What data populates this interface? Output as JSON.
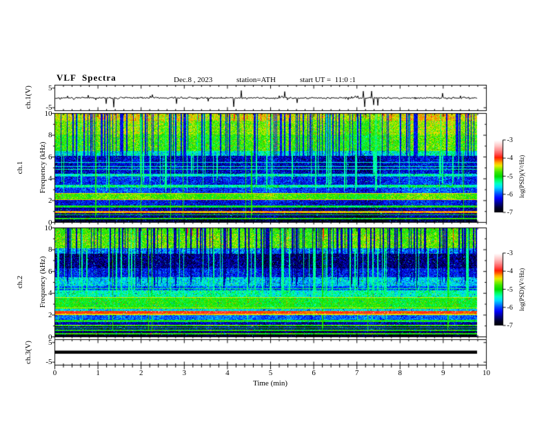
{
  "title": "VLF  Spectra",
  "header": {
    "date": "Dec.8 , 2023",
    "station": "station=ATH",
    "start_ut": "start UT =  11:0 :1"
  },
  "x_axis": {
    "label": "Time (min)",
    "min": 0,
    "max": 10,
    "tick_labels": [
      "0",
      "1",
      "2",
      "3",
      "4",
      "5",
      "6",
      "7",
      "8",
      "9",
      "10"
    ],
    "minor_per_major": 5
  },
  "panels": [
    {
      "name": "ch.1(V)",
      "yticks": [
        "5",
        "-5"
      ]
    },
    {
      "name": "ch.1",
      "axis": "Frequency (kHz)",
      "yticks": [
        "10",
        "8",
        "6",
        "4",
        "2",
        "0"
      ]
    },
    {
      "name": "ch.2",
      "axis": "Frequency (kHz)",
      "yticks": [
        "10",
        "8",
        "6",
        "4",
        "2",
        "0"
      ]
    },
    {
      "name": "ch.3(V)",
      "yticks": [
        "5",
        "-5"
      ]
    }
  ],
  "colorbar": {
    "label": "log(PSD)(V²/Hz)",
    "tick_labels": [
      "-3",
      "-4",
      "-5",
      "-6",
      "-7"
    ],
    "top_value": -3,
    "bottom_value": -7,
    "gradient_stops": [
      [
        -7.0,
        0,
        0,
        0
      ],
      [
        -6.75,
        0,
        0,
        40
      ],
      [
        -6.5,
        0,
        0,
        130
      ],
      [
        -6.2,
        0,
        0,
        255
      ],
      [
        -6.0,
        0,
        60,
        255
      ],
      [
        -5.8,
        0,
        140,
        255
      ],
      [
        -5.6,
        0,
        220,
        255
      ],
      [
        -5.4,
        0,
        255,
        200
      ],
      [
        -5.2,
        0,
        255,
        100
      ],
      [
        -5.0,
        0,
        220,
        0
      ],
      [
        -4.75,
        60,
        230,
        0
      ],
      [
        -4.55,
        150,
        240,
        0
      ],
      [
        -4.4,
        235,
        235,
        0
      ],
      [
        -4.25,
        255,
        180,
        0
      ],
      [
        -4.1,
        255,
        100,
        0
      ],
      [
        -3.95,
        255,
        30,
        0
      ],
      [
        -3.8,
        255,
        70,
        70
      ],
      [
        -3.55,
        255,
        140,
        140
      ],
      [
        -3.3,
        255,
        200,
        200
      ],
      [
        -3.0,
        255,
        255,
        255
      ]
    ]
  },
  "chart_data": [
    {
      "type": "line",
      "series": "ch.1 voltage waveform",
      "xlabel": "Time (min)",
      "ylabel": "ch.1(V)",
      "x_range": [
        0,
        9.79
      ],
      "y_range": [
        -5,
        5
      ],
      "baseline_V": 0,
      "noise_amplitude_V": 0.55,
      "downward_spikes_to_V": -5,
      "upward_spikes_to_V": 4,
      "line_color": "#000000"
    },
    {
      "type": "heatmap",
      "series": "ch.1 spectrogram",
      "xlabel": "Time (min)",
      "ylabel": "Frequency (kHz)",
      "x_range": [
        0,
        9.79
      ],
      "y_range": [
        0,
        10
      ],
      "z_label": "log(PSD)(V²/Hz)",
      "z_range": [
        -7,
        -3
      ],
      "band_format": [
        "f_high_kHz",
        "f_low_kHz",
        "mean_log_psd",
        "noise"
      ],
      "bands": [
        [
          10.0,
          9.4,
          -4.45,
          0.3
        ],
        [
          9.4,
          8.1,
          -4.65,
          0.3
        ],
        [
          8.1,
          6.6,
          -4.85,
          0.35
        ],
        [
          6.6,
          6.1,
          -5.5,
          0.4
        ],
        [
          6.1,
          4.45,
          -6.35,
          0.4
        ],
        [
          4.45,
          4.2,
          -5.5,
          0.3
        ],
        [
          4.2,
          3.45,
          -6.15,
          0.35
        ],
        [
          3.45,
          3.2,
          -5.35,
          0.3
        ],
        [
          3.2,
          2.65,
          -6.05,
          0.35
        ],
        [
          2.65,
          2.05,
          -4.8,
          0.3
        ],
        [
          2.05,
          1.5,
          -6.25,
          0.35
        ],
        [
          1.5,
          1.3,
          -5.0,
          0.25
        ],
        [
          1.3,
          1.0,
          -6.45,
          0.3
        ],
        [
          1.0,
          0.82,
          -4.35,
          0.25
        ],
        [
          0.82,
          0.38,
          -6.55,
          0.3
        ],
        [
          0.38,
          0.22,
          -5.0,
          0.25
        ],
        [
          0.22,
          0.0,
          -6.8,
          0.25
        ]
      ],
      "lines": [
        [
          5.5,
          -5.45
        ],
        [
          5.15,
          -5.4
        ],
        [
          4.85,
          -5.35
        ],
        [
          2.62,
          -4.35
        ],
        [
          2.08,
          -4.3
        ],
        [
          0.9,
          -4.2
        ],
        [
          0.62,
          -5.0
        ],
        [
          0.3,
          -4.8
        ]
      ],
      "streaks": {
        "dark": {
          "count": 150,
          "f_bottom": [
            4.3,
            6.5
          ],
          "level": -6.2
        },
        "bright": {
          "count": 60,
          "f_bottom": [
            2.7,
            4.5
          ],
          "level": -5.3
        },
        "red": {
          "count": 12,
          "f_bottom": [
            9.3,
            9.7
          ],
          "level": -3.9
        },
        "green": {
          "count": 8,
          "f_bottom": [
            0.3,
            0.5
          ],
          "level": -4.95
        }
      },
      "spots": {
        "f_min": 9.3,
        "prob": 0.012,
        "level": -4.0
      }
    },
    {
      "type": "heatmap",
      "series": "ch.2 spectrogram",
      "xlabel": "Time (min)",
      "ylabel": "Frequency (kHz)",
      "x_range": [
        0,
        9.79
      ],
      "y_range": [
        0,
        10
      ],
      "z_label": "log(PSD)(V²/Hz)",
      "z_range": [
        -7,
        -3
      ],
      "band_format": [
        "f_high_kHz",
        "f_low_kHz",
        "mean_log_psd",
        "noise"
      ],
      "bands": [
        [
          10.0,
          9.55,
          -4.8,
          0.3
        ],
        [
          9.55,
          8.2,
          -4.7,
          0.35
        ],
        [
          8.2,
          7.65,
          -5.8,
          0.45
        ],
        [
          7.65,
          6.3,
          -6.5,
          0.4
        ],
        [
          6.3,
          5.5,
          -6.15,
          0.35
        ],
        [
          5.5,
          4.65,
          -5.6,
          0.35
        ],
        [
          4.65,
          4.25,
          -5.95,
          0.3
        ],
        [
          4.25,
          3.65,
          -5.35,
          0.3
        ],
        [
          3.65,
          2.55,
          -4.95,
          0.3
        ],
        [
          2.55,
          2.32,
          -5.6,
          0.3
        ],
        [
          2.32,
          2.06,
          -3.95,
          0.15
        ],
        [
          2.06,
          1.96,
          -4.35,
          0.15
        ],
        [
          1.96,
          1.52,
          -5.9,
          0.35
        ],
        [
          1.52,
          1.32,
          -5.05,
          0.25
        ],
        [
          1.32,
          1.06,
          -6.35,
          0.3
        ],
        [
          1.06,
          0.9,
          -4.75,
          0.2
        ],
        [
          0.9,
          0.62,
          -6.5,
          0.3
        ],
        [
          0.62,
          0.46,
          -4.9,
          0.2
        ],
        [
          0.46,
          0.3,
          -6.6,
          0.25
        ],
        [
          0.3,
          0.16,
          -4.85,
          0.2
        ],
        [
          0.16,
          0.0,
          -6.8,
          0.2
        ]
      ],
      "lines": [
        [
          4.45,
          -5.2
        ],
        [
          3.6,
          -4.4
        ],
        [
          2.6,
          -4.5
        ],
        [
          1.45,
          -4.9
        ],
        [
          0.75,
          -5.0
        ]
      ],
      "streaks": {
        "dark": {
          "count": 170,
          "f_bottom": [
            4.4,
            7.8
          ],
          "level": -6.4
        },
        "bright": {
          "count": 70,
          "f_bottom": [
            1.3,
            3.6
          ],
          "level": -5.3
        },
        "red": {
          "count": 5,
          "f_bottom": [
            8.5,
            9.5
          ],
          "level": -3.95
        },
        "green": {
          "count": 6,
          "f_bottom": [
            0.4,
            0.6
          ],
          "level": -4.95
        }
      },
      "spots": {
        "f_min": 8.2,
        "prob": 0.004,
        "level": -4.0
      }
    },
    {
      "type": "line",
      "series": "ch.3 voltage (flat)",
      "xlabel": "Time (min)",
      "ylabel": "ch.3(V)",
      "x_range": [
        0,
        9.79
      ],
      "y_range": [
        -5,
        5
      ],
      "constant_value_V": 0,
      "line_thickness_px": 4,
      "line_color": "#000000"
    }
  ]
}
